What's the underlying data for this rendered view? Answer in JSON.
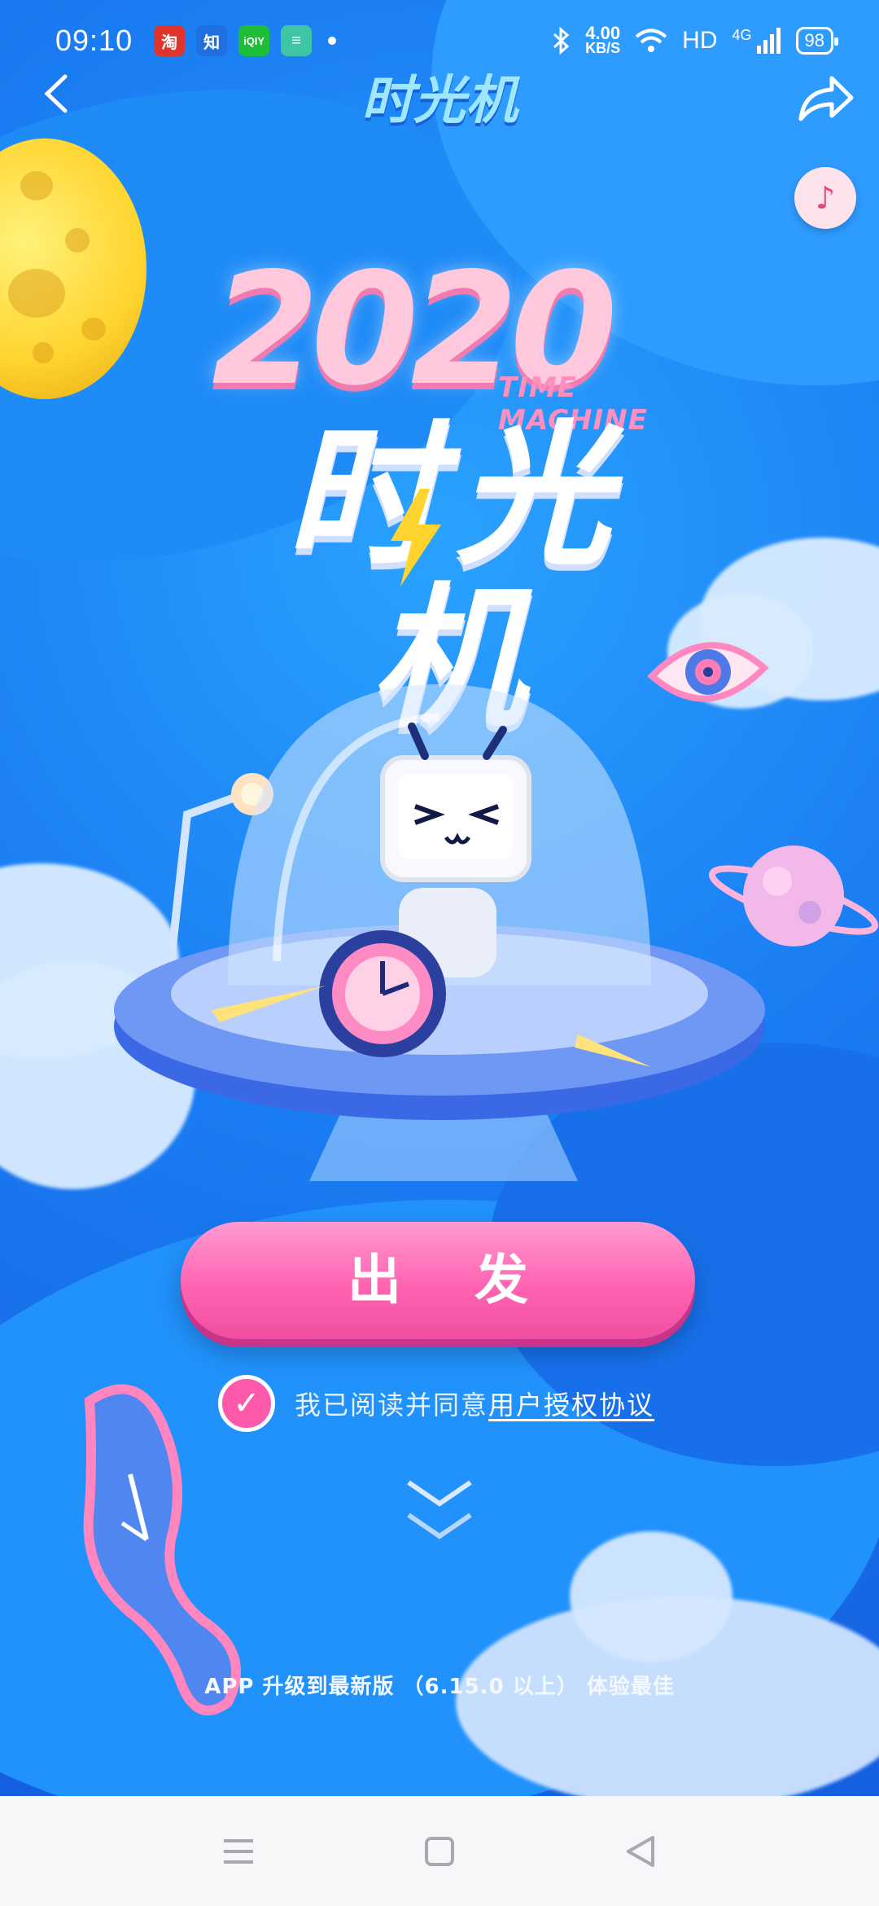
{
  "status_bar": {
    "time": "09:10",
    "notification_apps": [
      {
        "name": "taobao-icon",
        "glyph": "淘",
        "color": "#e0342a"
      },
      {
        "name": "zhihu-icon",
        "glyph": "知",
        "color": "#1f6fe0"
      },
      {
        "name": "iqiyi-icon",
        "glyph": "iQIY",
        "color": "#1fbe38"
      },
      {
        "name": "app-icon",
        "glyph": "≡",
        "color": "#3fc4a6"
      }
    ],
    "network_speed_value": "4.00",
    "network_speed_unit": "KB/S",
    "hd_label": "HD",
    "signal_label": "4G",
    "battery": "98"
  },
  "header": {
    "title": "时光机",
    "back_icon": "chevron-left-icon",
    "share_icon": "share-icon",
    "music_icon": "music-note-icon"
  },
  "logo": {
    "year": "2020",
    "subtitle": "TIME MACHINE",
    "main_title": "时光机"
  },
  "actions": {
    "start_label": "出发",
    "agree_text": "我已阅读并同意",
    "agreement_link": "用户授权协议",
    "agreed": true
  },
  "footer_note": "APP 升级到最新版 （6.15.0 以上） 体验最佳",
  "nav_bar": {
    "menu_icon": "menu-icon",
    "home_icon": "home-square-icon",
    "back_icon": "back-triangle-icon"
  },
  "colors": {
    "primary_bg": "#1a7cf2",
    "button_pink": "#ff64b1",
    "accent_yellow": "#ffd42e"
  }
}
